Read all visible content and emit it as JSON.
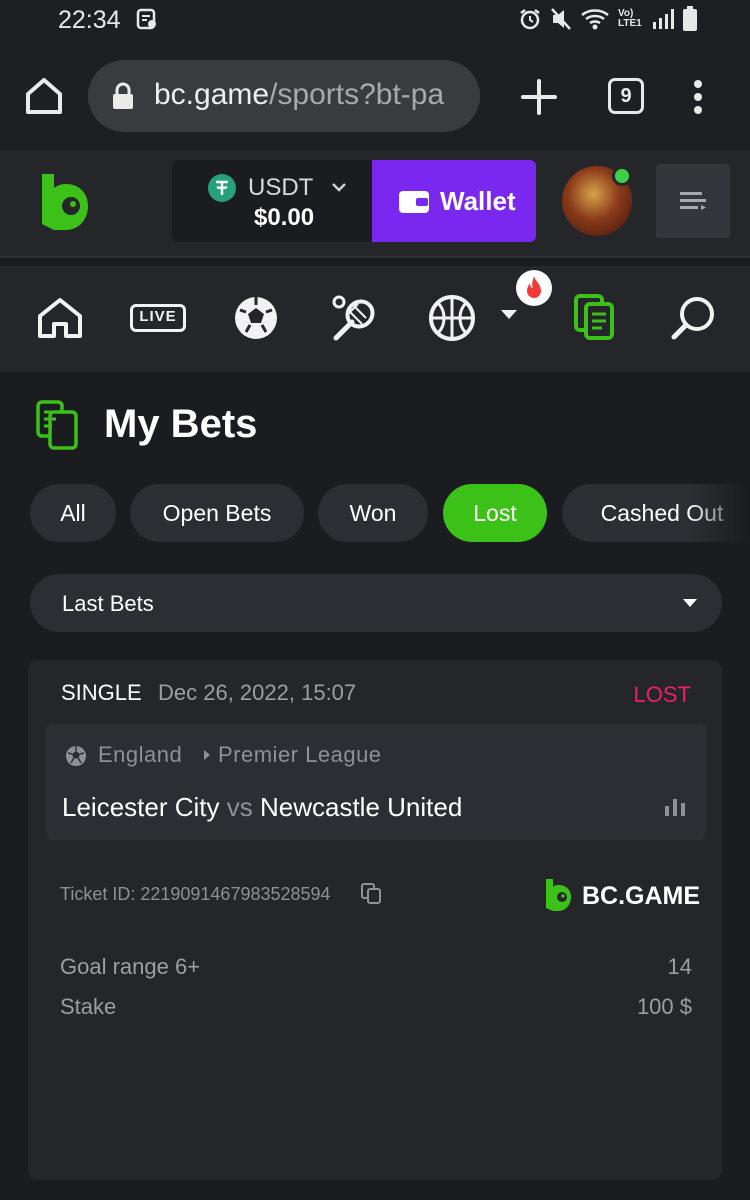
{
  "status_bar": {
    "time": "22:34",
    "network": "Vo) LTE1",
    "icons": [
      "note-icon",
      "alarm-icon",
      "mute-icon",
      "wifi-icon",
      "signal-icon",
      "battery-icon"
    ]
  },
  "browser": {
    "url_host": "bc.game",
    "url_path": "/sports?bt-pa",
    "tab_count": "9"
  },
  "header": {
    "currency": "USDT",
    "balance": "$0.00",
    "wallet_label": "Wallet"
  },
  "sports_nav": {
    "live_label": "LIVE",
    "items": [
      "home-icon",
      "live-icon",
      "soccer-icon",
      "tennis-icon",
      "basketball-icon",
      "more-caret",
      "my-bets-icon",
      "search-icon"
    ]
  },
  "page": {
    "title": "My Bets",
    "filters": [
      "All",
      "Open Bets",
      "Won",
      "Lost",
      "Cashed Out"
    ],
    "active_filter": "Lost",
    "dropdown_label": "Last Bets"
  },
  "bet": {
    "type": "SINGLE",
    "date": "Dec 26, 2022, 15:07",
    "status": "LOST",
    "country": "England",
    "league": "Premier League",
    "home_team": "Leicester City",
    "vs": "vs",
    "away_team": "Newcastle United",
    "ticket_id": "Ticket ID: 2219091467983528594",
    "brand": "BC.GAME",
    "selection": "Goal range 6+",
    "odds": "14",
    "stake_label": "Stake",
    "stake_value": "100 $"
  },
  "colors": {
    "accent_green": "#3bc117",
    "wallet_purple": "#7a28f0",
    "lost_red": "#ed1f63"
  }
}
